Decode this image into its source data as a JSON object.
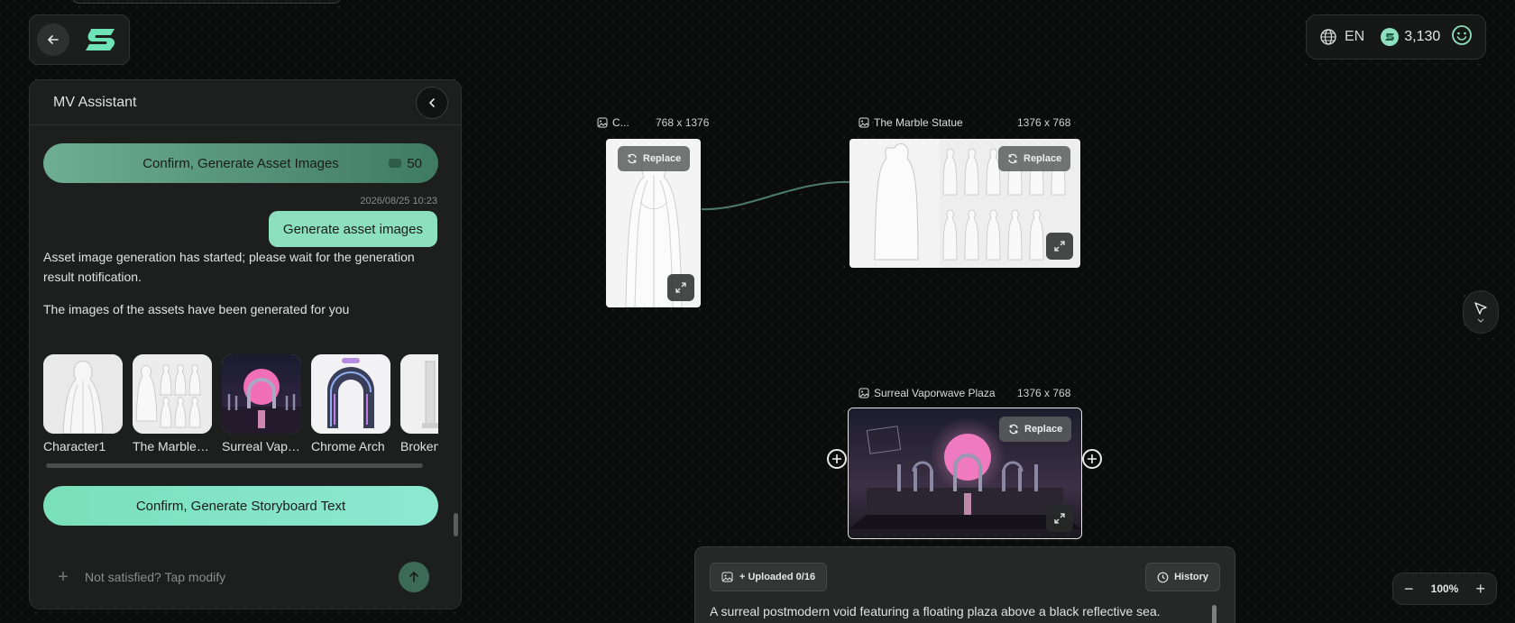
{
  "header": {
    "back_label": "",
    "logo_name": "app-logo"
  },
  "topbar": {
    "language": "EN",
    "credits": "3,130"
  },
  "assistant": {
    "title": "MV Assistant",
    "confirm_assets": {
      "label": "Confirm, Generate Asset Images",
      "cost": "50"
    },
    "timestamp": "2026/08/25 10:23",
    "user_message": "Generate asset images",
    "msg_started": "Asset image generation has started; please wait for the generation result notification.",
    "msg_done": "The images of the assets have been generated for you",
    "assets": [
      {
        "label": "Character1"
      },
      {
        "label": "The Marble Statue"
      },
      {
        "label": "Surreal Vaporwave Plaza"
      },
      {
        "label": "Chrome Arch"
      },
      {
        "label": "Broken"
      }
    ],
    "confirm_storyboard": "Confirm, Generate Storyboard Text",
    "input_placeholder": "Not satisfied? Tap modify"
  },
  "canvas": {
    "nodes": [
      {
        "title": "C...",
        "size": "768 x 1376",
        "replace": "Replace"
      },
      {
        "title": "The Marble Statue",
        "size": "1376 x 768",
        "replace": "Replace"
      },
      {
        "title": "Surreal Vaporwave Plaza",
        "size": "1376 x 768",
        "replace": "Replace"
      }
    ],
    "zoom": "100%"
  },
  "prompt_panel": {
    "uploaded": "+ Uploaded 0/16",
    "history": "History",
    "text": "A surreal postmodern void featuring a floating plaza above a black reflective sea."
  },
  "colors": {
    "accent": "#8de0bd",
    "accent_dark": "#3f7a62",
    "background": "#0b0c0c"
  }
}
